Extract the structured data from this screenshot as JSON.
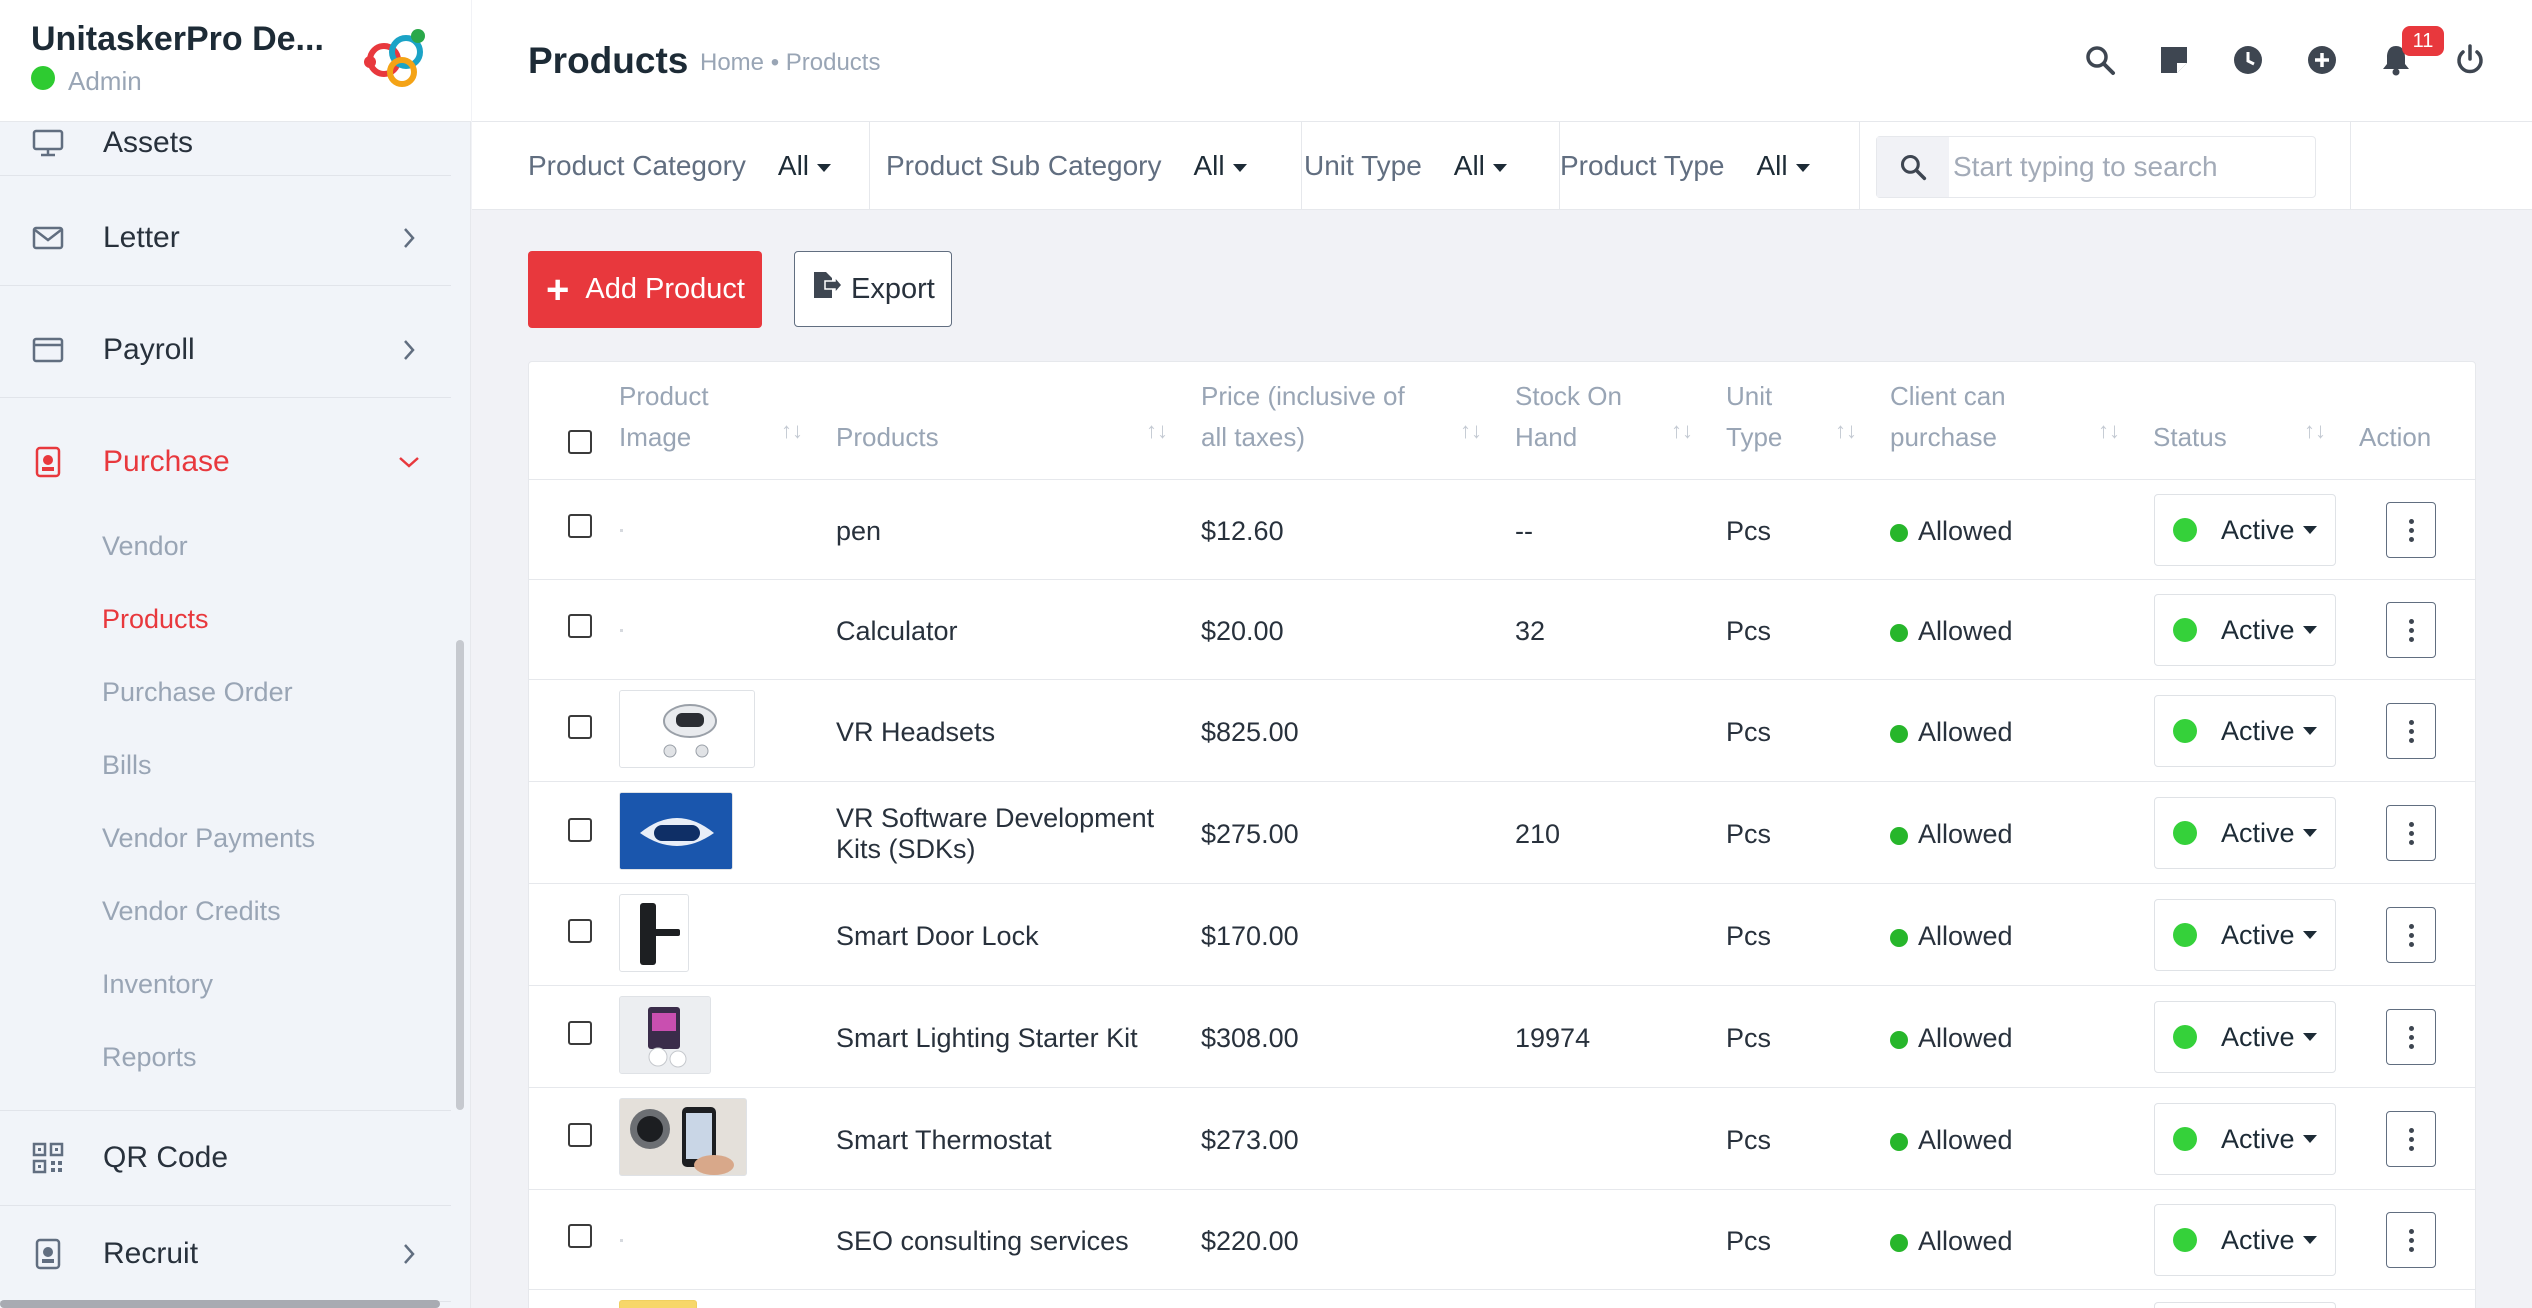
{
  "brand": {
    "name": "UnitaskerPro De...",
    "role": "Admin"
  },
  "sidebar": {
    "items": [
      {
        "label": "Assets",
        "icon": "monitor-icon"
      },
      {
        "label": "Letter",
        "icon": "envelope-icon"
      },
      {
        "label": "Payroll",
        "icon": "browser-window-icon"
      },
      {
        "label": "Purchase",
        "icon": "purchase-badge-icon"
      },
      {
        "label": "QR Code",
        "icon": "qr-code-icon"
      },
      {
        "label": "Recruit",
        "icon": "id-badge-icon"
      }
    ],
    "purchase_sub": [
      "Vendor",
      "Products",
      "Purchase Order",
      "Bills",
      "Vendor Payments",
      "Vendor Credits",
      "Inventory",
      "Reports"
    ]
  },
  "header": {
    "title": "Products",
    "breadcrumb": "Home • Products",
    "notification_count": "11"
  },
  "filters": {
    "product_category": {
      "label": "Product Category",
      "value": "All"
    },
    "product_sub_category": {
      "label": "Product Sub Category",
      "value": "All"
    },
    "unit_type": {
      "label": "Unit Type",
      "value": "All"
    },
    "product_type": {
      "label": "Product Type",
      "value": "All"
    },
    "search_placeholder": "Start typing to search"
  },
  "actions": {
    "add": "Add Product",
    "export": "Export"
  },
  "table": {
    "headers": {
      "image_1": "Product",
      "image_2": "Image",
      "products": "Products",
      "price_1": "Price (inclusive of",
      "price_2": "all taxes)",
      "stock_1": "Stock On",
      "stock_2": "Hand",
      "unit_1": "Unit",
      "unit_2": "Type",
      "client_1": "Client can",
      "client_2": "purchase",
      "status": "Status",
      "action": "Action"
    },
    "rows": [
      {
        "name": "pen",
        "price": "$12.60",
        "stock": "--",
        "unit": "Pcs",
        "client": "Allowed",
        "status": "Active"
      },
      {
        "name": "Calculator",
        "price": "$20.00",
        "stock": "32",
        "unit": "Pcs",
        "client": "Allowed",
        "status": "Active"
      },
      {
        "name": "VR Headsets",
        "price": "$825.00",
        "stock": "",
        "unit": "Pcs",
        "client": "Allowed",
        "status": "Active"
      },
      {
        "name": "VR Software Development Kits (SDKs)",
        "name_1": "VR Software Development",
        "name_2": "Kits (SDKs)",
        "price": "$275.00",
        "stock": "210",
        "unit": "Pcs",
        "client": "Allowed",
        "status": "Active"
      },
      {
        "name": "Smart Door Lock",
        "price": "$170.00",
        "stock": "",
        "unit": "Pcs",
        "client": "Allowed",
        "status": "Active"
      },
      {
        "name": "Smart Lighting Starter Kit",
        "price": "$308.00",
        "stock": "19974",
        "unit": "Pcs",
        "client": "Allowed",
        "status": "Active"
      },
      {
        "name": "Smart Thermostat",
        "price": "$273.00",
        "stock": "",
        "unit": "Pcs",
        "client": "Allowed",
        "status": "Active"
      },
      {
        "name": "SEO consulting services",
        "price": "$220.00",
        "stock": "",
        "unit": "Pcs",
        "client": "Allowed",
        "status": "Active"
      }
    ]
  },
  "colors": {
    "accent": "#e8383d",
    "active_status": "#35d13a",
    "allowed": "#27b62b",
    "sidebar_bg": "#f1f4f9"
  }
}
